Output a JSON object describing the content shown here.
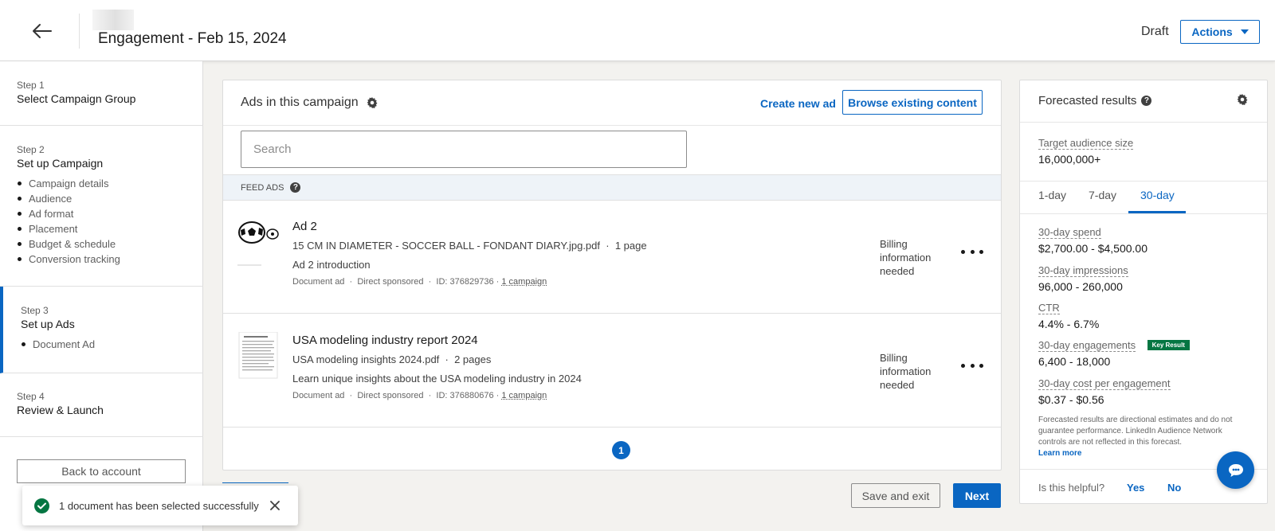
{
  "header": {
    "title": "Engagement - Feb 15, 2024",
    "status": "Draft",
    "actions_label": "Actions"
  },
  "sidebar": {
    "steps": [
      {
        "num": "Step 1",
        "title": "Select Campaign Group",
        "items": []
      },
      {
        "num": "Step 2",
        "title": "Set up Campaign",
        "items": [
          "Campaign details",
          "Audience",
          "Ad format",
          "Placement",
          "Budget & schedule",
          "Conversion tracking"
        ]
      },
      {
        "num": "Step 3",
        "title": "Set up Ads",
        "items": [
          "Document Ad"
        ]
      },
      {
        "num": "Step 4",
        "title": "Review & Launch",
        "items": []
      }
    ],
    "back_label": "Back to account"
  },
  "ads_card": {
    "title": "Ads in this campaign",
    "create_label": "Create new ad",
    "browse_label": "Browse existing content",
    "search_placeholder": "Search",
    "section_label": "FEED ADS",
    "ads": [
      {
        "title": "Ad 2",
        "file": "15 CM IN DIAMETER - SOCCER BALL - FONDANT DIARY.jpg.pdf",
        "pages": "1 page",
        "description": "Ad 2 introduction",
        "type": "Document ad",
        "sponsor": "Direct sponsored",
        "id": "ID: 376829736",
        "campaigns": "1 campaign",
        "billing": "Billing information needed"
      },
      {
        "title": "USA modeling industry report 2024",
        "file": "USA modeling insights 2024.pdf",
        "pages": "2 pages",
        "description": "Learn unique insights about the USA modeling industry in 2024",
        "type": "Document ad",
        "sponsor": "Direct sponsored",
        "id": "ID: 376880676",
        "campaigns": "1 campaign",
        "billing": "Billing information needed"
      }
    ],
    "page": "1"
  },
  "forecast": {
    "title": "Forecasted results",
    "audience_label": "Target audience size",
    "audience_value": "16,000,000+",
    "tabs": [
      "1-day",
      "7-day",
      "30-day"
    ],
    "active_tab": "30-day",
    "metrics": [
      {
        "label": "30-day spend",
        "value": "$2,700.00 - $4,500.00",
        "badge": ""
      },
      {
        "label": "30-day impressions",
        "value": "96,000 - 260,000",
        "badge": ""
      },
      {
        "label": "CTR",
        "value": "4.4% - 6.7%",
        "badge": ""
      },
      {
        "label": "30-day engagements",
        "value": "6,400 - 18,000",
        "badge": "Key Result"
      },
      {
        "label": "30-day cost per engagement",
        "value": "$0.37 - $0.56",
        "badge": ""
      }
    ],
    "disclaimer": "Forecasted results are directional estimates and do not guarantee performance. LinkedIn Audience Network controls are not reflected in this forecast.",
    "learn_more": "Learn more",
    "helpful_question": "Is this helpful?",
    "yes_label": "Yes",
    "no_label": "No"
  },
  "footer": {
    "save_exit_label": "Save and exit",
    "next_label": "Next"
  },
  "toast": {
    "message": "1 document has been selected successfully"
  },
  "colors": {
    "accent": "#0a66c2",
    "success": "#057642",
    "page_bg": "#f3f2ef"
  }
}
